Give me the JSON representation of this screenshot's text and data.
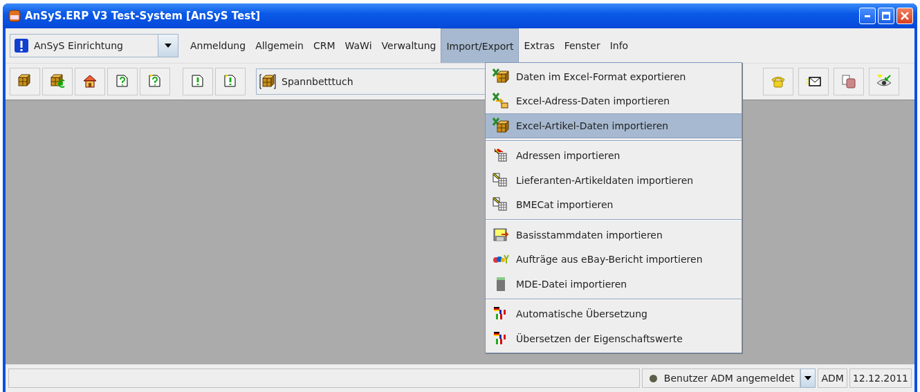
{
  "window": {
    "title": "AnSyS.ERP V3 Test-System [AnSyS Test]"
  },
  "module_selector": {
    "value": "AnSyS Einrichtung"
  },
  "menu_bar": [
    {
      "label": "Anmeldung",
      "selected": false
    },
    {
      "label": "Allgemein",
      "selected": false
    },
    {
      "label": "CRM",
      "selected": false
    },
    {
      "label": "WaWi",
      "selected": false
    },
    {
      "label": "Verwaltung",
      "selected": false
    },
    {
      "label": "Import/Export",
      "selected": true
    },
    {
      "label": "Extras",
      "selected": false
    },
    {
      "label": "Fenster",
      "selected": false
    },
    {
      "label": "Info",
      "selected": false
    }
  ],
  "toolbar": {
    "article_field": {
      "value": "Spannbetttuch"
    }
  },
  "dropdown_menu": {
    "groups": [
      [
        {
          "label": "Daten im Excel-Format exportieren",
          "selected": false
        },
        {
          "label": "Excel-Adress-Daten importieren",
          "selected": false
        },
        {
          "label": "Excel-Artikel-Daten importieren",
          "selected": true
        }
      ],
      [
        {
          "label": "Adressen importieren",
          "selected": false
        },
        {
          "label": "Lieferanten-Artikeldaten importieren",
          "selected": false
        },
        {
          "label": "BMECat importieren",
          "selected": false
        }
      ],
      [
        {
          "label": "Basisstammdaten importieren",
          "selected": false
        },
        {
          "label": "Aufträge aus eBay-Bericht importieren",
          "selected": false
        },
        {
          "label": "MDE-Datei importieren",
          "selected": false
        }
      ],
      [
        {
          "label": "Automatische Übersetzung",
          "selected": false
        },
        {
          "label": "Übersetzen der Eigenschaftswerte",
          "selected": false
        }
      ]
    ]
  },
  "status_bar": {
    "status": {
      "text": "Benutzer ADM angemeldet",
      "color": "#5a5f48"
    },
    "user": "ADM",
    "date": "12.12.2011"
  }
}
